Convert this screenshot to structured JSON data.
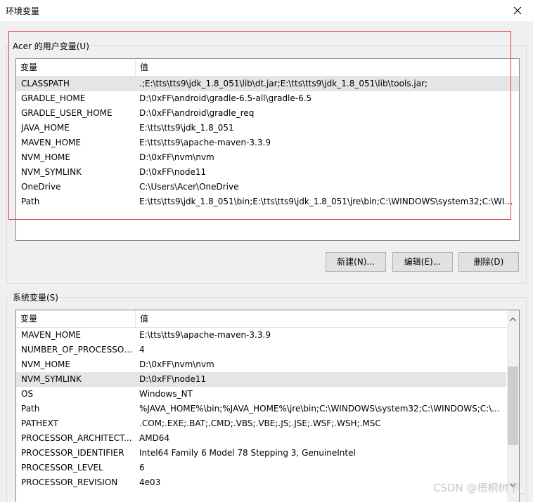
{
  "window": {
    "title": "环境变量",
    "close_icon": "close-icon"
  },
  "user_vars": {
    "group_label": "Acer 的用户变量(U)",
    "col_var": "变量",
    "col_val": "值",
    "rows": [
      {
        "name": "CLASSPATH",
        "value": ".;E:\\tts\\tts9\\jdk_1.8_051\\lib\\dt.jar;E:\\tts\\tts9\\jdk_1.8_051\\lib\\tools.jar;",
        "selected": true
      },
      {
        "name": "GRADLE_HOME",
        "value": "D:\\0xFF\\android\\gradle-6.5-all\\gradle-6.5"
      },
      {
        "name": "GRADLE_USER_HOME",
        "value": "D:\\0xFF\\android\\gradle_req"
      },
      {
        "name": "JAVA_HOME",
        "value": "E:\\tts\\tts9\\jdk_1.8_051"
      },
      {
        "name": "MAVEN_HOME",
        "value": "E:\\tts\\tts9\\apache-maven-3.3.9"
      },
      {
        "name": "NVM_HOME",
        "value": "D:\\0xFF\\nvm\\nvm"
      },
      {
        "name": "NVM_SYMLINK",
        "value": "D:\\0xFF\\node11"
      },
      {
        "name": "OneDrive",
        "value": "C:\\Users\\Acer\\OneDrive"
      },
      {
        "name": "Path",
        "value": "E:\\tts\\tts9\\jdk_1.8_051\\bin;E:\\tts\\tts9\\jdk_1.8_051\\jre\\bin;C:\\WINDOWS\\system32;C:\\WIND..."
      }
    ],
    "buttons": {
      "new": "新建(N)...",
      "edit": "编辑(E)...",
      "delete": "删除(D)"
    }
  },
  "system_vars": {
    "group_label": "系统变量(S)",
    "col_var": "变量",
    "col_val": "值",
    "rows": [
      {
        "name": "MAVEN_HOME",
        "value": "E:\\tts\\tts9\\apache-maven-3.3.9"
      },
      {
        "name": "NUMBER_OF_PROCESSORS",
        "value": "4"
      },
      {
        "name": "NVM_HOME",
        "value": "D:\\0xFF\\nvm\\nvm"
      },
      {
        "name": "NVM_SYMLINK",
        "value": "D:\\0xFF\\node11",
        "selected": true
      },
      {
        "name": "OS",
        "value": "Windows_NT"
      },
      {
        "name": "Path",
        "value": "%JAVA_HOME%\\bin;%JAVA_HOME%\\jre\\bin;C:\\WINDOWS\\system32;C:\\WINDOWS;C:\\..."
      },
      {
        "name": "PATHEXT",
        "value": ".COM;.EXE;.BAT;.CMD;.VBS;.VBE;.JS;.JSE;.WSF;.WSH;.MSC"
      },
      {
        "name": "PROCESSOR_ARCHITECT...",
        "value": "AMD64"
      },
      {
        "name": "PROCESSOR_IDENTIFIER",
        "value": "Intel64 Family 6 Model 78 Stepping 3, GenuineIntel"
      },
      {
        "name": "PROCESSOR_LEVEL",
        "value": "6"
      },
      {
        "name": "PROCESSOR_REVISION",
        "value": "4e03"
      }
    ]
  },
  "watermark": "CSDN @梧桐树下_",
  "colors": {
    "highlight": "#e03a3a",
    "selected_row": "#e5e5e5"
  }
}
